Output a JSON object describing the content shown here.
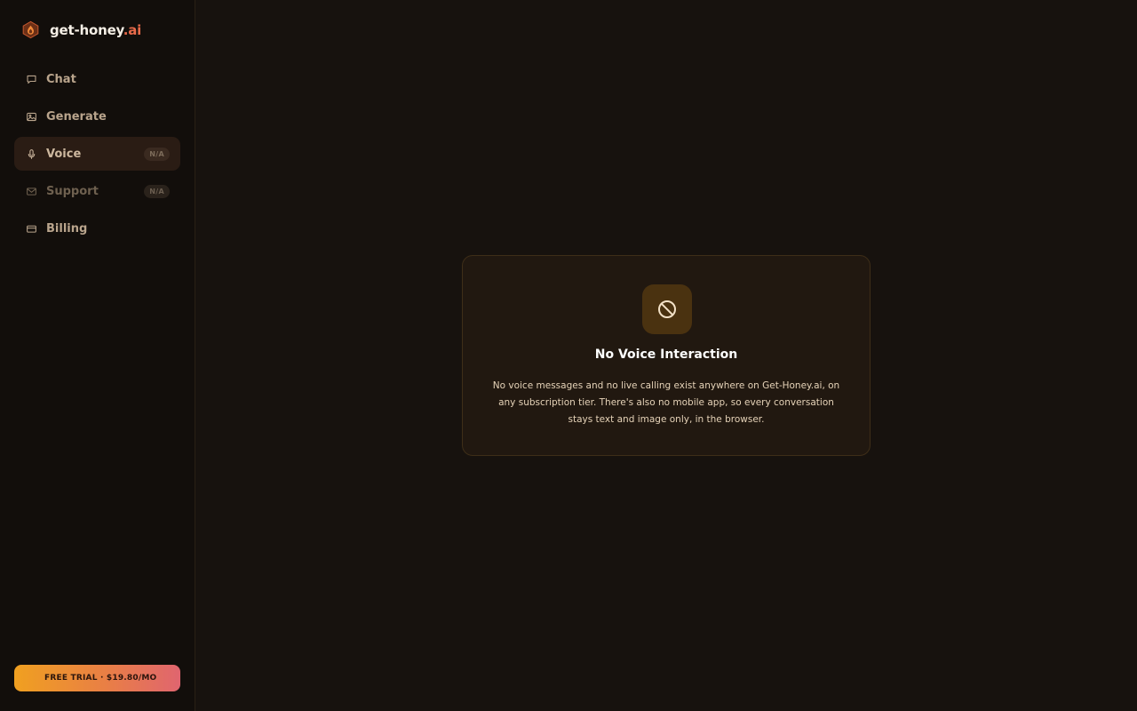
{
  "brand": {
    "name": "get-honey",
    "tld": ".ai",
    "logo_icon": "honey-hexagon-icon"
  },
  "sidebar": {
    "items": [
      {
        "label": "Chat",
        "icon": "chat-bubble-icon",
        "badge": "",
        "active": false,
        "dimmed": false
      },
      {
        "label": "Generate",
        "icon": "image-icon",
        "badge": "",
        "active": false,
        "dimmed": false
      },
      {
        "label": "Voice",
        "icon": "microphone-icon",
        "badge": "N/A",
        "active": true,
        "dimmed": false
      },
      {
        "label": "Support",
        "icon": "mail-icon",
        "badge": "N/A",
        "active": false,
        "dimmed": true
      },
      {
        "label": "Billing",
        "icon": "credit-card-icon",
        "badge": "",
        "active": false,
        "dimmed": false
      }
    ],
    "cta_label": "FREE TRIAL · $19.80/MO"
  },
  "notice": {
    "icon": "prohibited-icon",
    "title": "No Voice Interaction",
    "body": "No voice messages and no live calling exist anywhere on Get-Honey.ai, on any subscription tier. There's also no mobile app, so every conversation stays text and image only, in the browser."
  },
  "colors": {
    "accent_orange": "#f0a020",
    "accent_coral": "#e0656f",
    "brand_tld": "#e86a4a",
    "background": "#17120e",
    "sidebar_bg": "#120e0b"
  }
}
